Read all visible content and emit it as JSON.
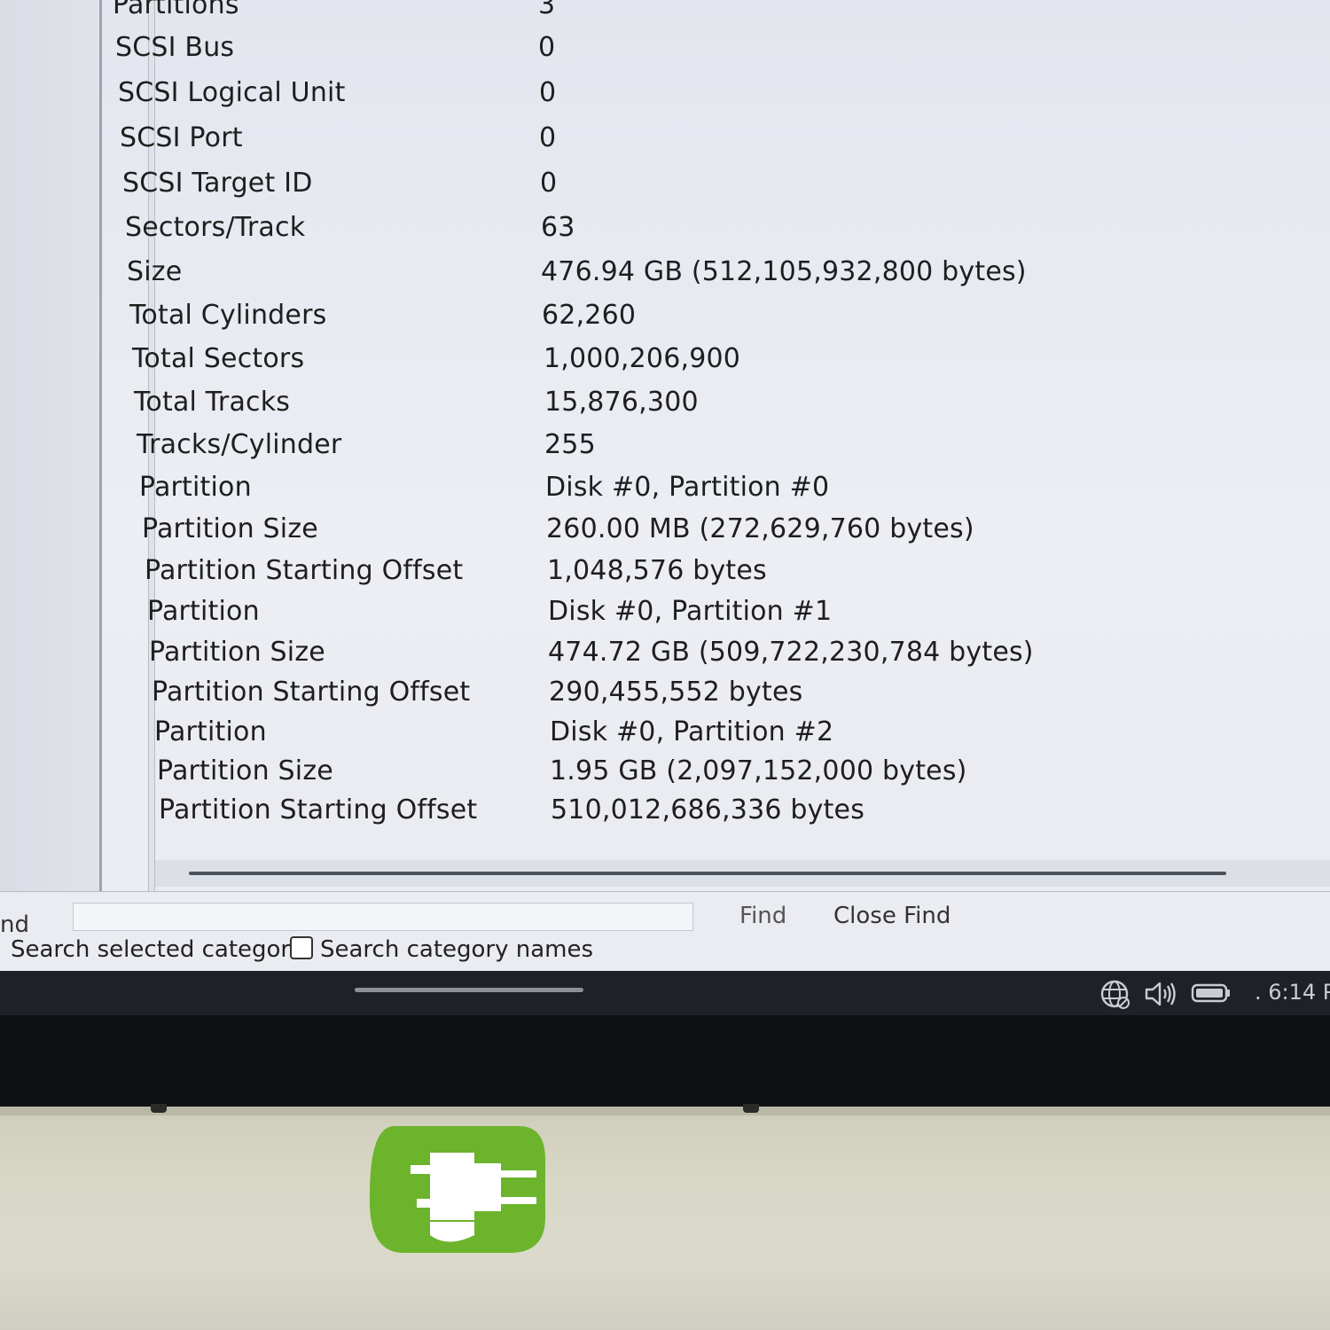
{
  "details": {
    "rows": [
      {
        "label": "Partitions",
        "value": "3"
      },
      {
        "label": "SCSI Bus",
        "value": "0"
      },
      {
        "label": "SCSI Logical Unit",
        "value": "0"
      },
      {
        "label": "SCSI Port",
        "value": "0"
      },
      {
        "label": "SCSI Target ID",
        "value": "0"
      },
      {
        "label": "Sectors/Track",
        "value": "63"
      },
      {
        "label": "Size",
        "value": "476.94 GB (512,105,932,800 bytes)"
      },
      {
        "label": "Total Cylinders",
        "value": "62,260"
      },
      {
        "label": "Total Sectors",
        "value": "1,000,206,900"
      },
      {
        "label": "Total Tracks",
        "value": "15,876,300"
      },
      {
        "label": "Tracks/Cylinder",
        "value": "255"
      },
      {
        "label": "Partition",
        "value": "Disk #0, Partition #0"
      },
      {
        "label": "Partition Size",
        "value": "260.00 MB (272,629,760 bytes)"
      },
      {
        "label": "Partition Starting Offset",
        "value": "1,048,576 bytes"
      },
      {
        "label": "Partition",
        "value": "Disk #0, Partition #1"
      },
      {
        "label": "Partition Size",
        "value": "474.72 GB (509,722,230,784 bytes)"
      },
      {
        "label": "Partition Starting Offset",
        "value": "290,455,552 bytes"
      },
      {
        "label": "Partition",
        "value": "Disk #0, Partition #2"
      },
      {
        "label": "Partition Size",
        "value": "1.95 GB (2,097,152,000 bytes)"
      },
      {
        "label": "Partition Starting Offset",
        "value": "510,012,686,336 bytes"
      }
    ]
  },
  "find_bar": {
    "label": "nd",
    "input_value": "",
    "find_button": "Find",
    "close_find_button": "Close Find",
    "option_selected_category": "Search selected categor",
    "option_category_names": "Search category names"
  },
  "taskbar": {
    "icons": [
      "network-globe-icon",
      "volume-icon",
      "battery-icon"
    ],
    "clock": ". 6:14 P"
  },
  "colors": {
    "screen_bg": "#e6e9f0",
    "taskbar_bg": "#1e2126",
    "sticker_green": "#6cb42c",
    "chassis": "#d6d4c3"
  }
}
